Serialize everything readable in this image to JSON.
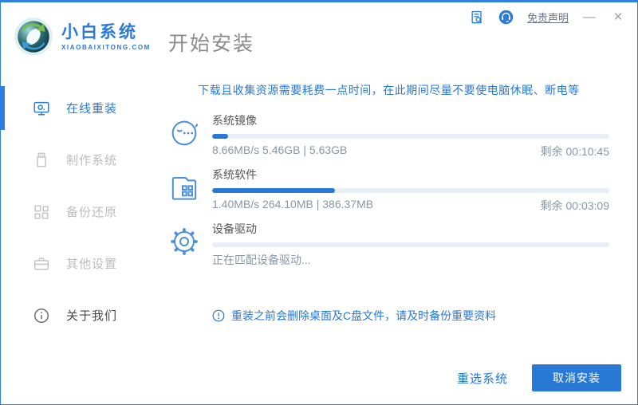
{
  "header": {
    "logo_title": "小白系统",
    "logo_subtitle": "XIAOBAIXITONG.COM",
    "page_title": "开始安装",
    "disclaimer_link": "免责声明",
    "minimize_label": "—",
    "close_label": "×"
  },
  "sidebar": {
    "items": [
      {
        "label": "在线重装",
        "icon": "monitor-icon",
        "state": "active"
      },
      {
        "label": "制作系统",
        "icon": "usb-icon",
        "state": "muted"
      },
      {
        "label": "备份还原",
        "icon": "blocks-icon",
        "state": "muted"
      },
      {
        "label": "其他设置",
        "icon": "briefcase-icon",
        "state": "muted"
      },
      {
        "label": "关于我们",
        "icon": "info-icon",
        "state": "normal"
      }
    ]
  },
  "main": {
    "warning": "下载且收集资源需要耗费一点时间，在此期间尽量不要使电脑休眠、断电等",
    "tasks": [
      {
        "name": "系统镜像",
        "icon": "face-icon",
        "progress_percent": 4,
        "stats": "8.66MB/s 5.46GB | 5.63GB",
        "remaining": "剩余 00:10:45"
      },
      {
        "name": "系统软件",
        "icon": "folder-icon",
        "progress_percent": 31,
        "stats": "1.40MB/s 264.10MB | 386.37MB",
        "remaining": "剩余 00:03:09"
      },
      {
        "name": "设备驱动",
        "icon": "gear-icon",
        "progress_percent": 0,
        "stats": "正在匹配设备驱动...",
        "remaining": ""
      }
    ],
    "notice": "重装之前会删除桌面及C盘文件，请及时备份重要资料"
  },
  "footer": {
    "reselect_button": "重选系统",
    "cancel_button": "取消安装"
  },
  "colors": {
    "accent": "#2878d6",
    "border": "#2f7fe0",
    "track": "#e9eef6"
  }
}
